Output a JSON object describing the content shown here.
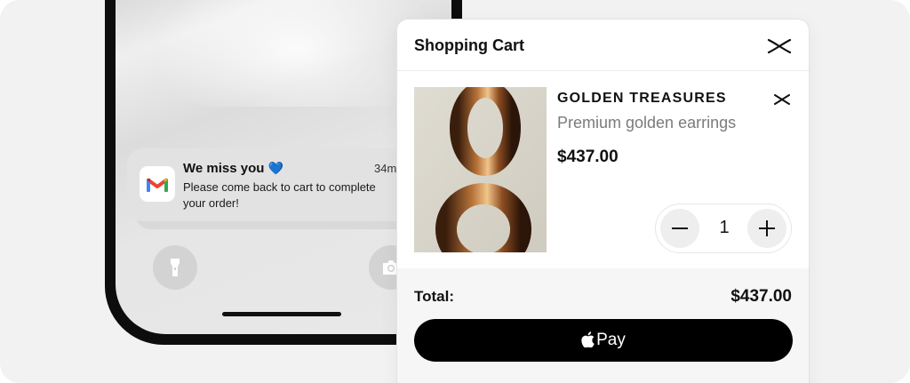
{
  "notification": {
    "app_icon": "gmail-icon",
    "title": "We miss you",
    "emoji": "💙",
    "time": "34m",
    "body": "Please come back to cart to complete your order!"
  },
  "lockscreen": {
    "left_button_icon": "flashlight-icon",
    "right_button_icon": "camera-icon"
  },
  "cart": {
    "title": "Shopping Cart",
    "close_icon": "close-icon",
    "item": {
      "name": "GOLDEN TREASURES",
      "description": "Premium golden earrings",
      "price": "$437.00",
      "quantity": "1",
      "remove_icon": "remove-icon",
      "image_icon": "golden-earrings-photo"
    },
    "total_label": "Total:",
    "total_value": "$437.00",
    "pay_label": "Pay"
  },
  "colors": {
    "background": "#f2f2f2",
    "pay_button": "#000000",
    "heart": "#2d7be5"
  }
}
